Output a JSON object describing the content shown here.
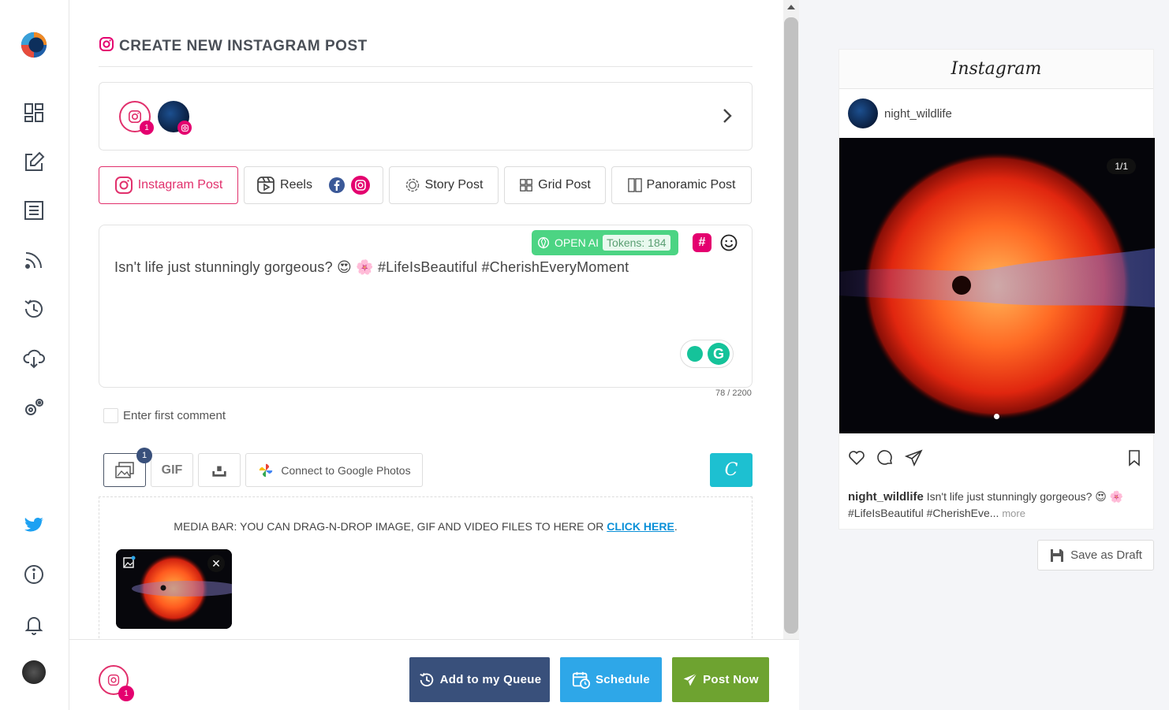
{
  "sidebar": {
    "items": [
      {
        "name": "dashboard"
      },
      {
        "name": "compose"
      },
      {
        "name": "posts"
      },
      {
        "name": "rss"
      },
      {
        "name": "queue"
      },
      {
        "name": "download"
      },
      {
        "name": "settings"
      },
      {
        "name": "twitter"
      },
      {
        "name": "info"
      },
      {
        "name": "notifications"
      },
      {
        "name": "profile"
      }
    ]
  },
  "header": {
    "title": "CREATE NEW INSTAGRAM POST"
  },
  "accounts": {
    "selected_count": "1"
  },
  "tabs": [
    {
      "label": "Instagram Post"
    },
    {
      "label": "Reels"
    },
    {
      "label": "Story Post"
    },
    {
      "label": "Grid Post"
    },
    {
      "label": "Panoramic Post"
    }
  ],
  "editor": {
    "openai_label": "OPEN AI",
    "tokens_label": "Tokens: 184",
    "text": "Isn't life just stunningly gorgeous? 😍 🌸  #LifeIsBeautiful #CherishEveryMoment",
    "counter": "78 / 2200"
  },
  "first_comment": {
    "label": "Enter first comment"
  },
  "media_tools": {
    "image_badge": "1",
    "gif_label": "GIF",
    "google_photos_label": "Connect to Google Photos"
  },
  "media_bar": {
    "text": "MEDIA BAR: YOU CAN DRAG-N-DROP IMAGE, GIF AND VIDEO FILES TO HERE OR ",
    "link": "CLICK HERE",
    "suffix": "."
  },
  "footer": {
    "account_badge": "1",
    "queue_label": "Add to my Queue",
    "schedule_label": "Schedule",
    "post_now_label": "Post Now"
  },
  "preview": {
    "brand": "Instagram",
    "username": "night_wildlife",
    "image_counter": "1/1",
    "caption_user": "night_wildlife",
    "caption_text": "Isn't life just stunningly gorgeous? 😍 🌸 #LifeIsBeautiful #CherishEve...",
    "more_label": "more",
    "save_draft_label": "Save as Draft"
  },
  "colors": {
    "instagram": "#e1306c",
    "queue": "#39507b",
    "schedule": "#2ea7e8",
    "post_now": "#6ea330",
    "openai": "#4cd483",
    "canva": "#1dc0d1"
  }
}
